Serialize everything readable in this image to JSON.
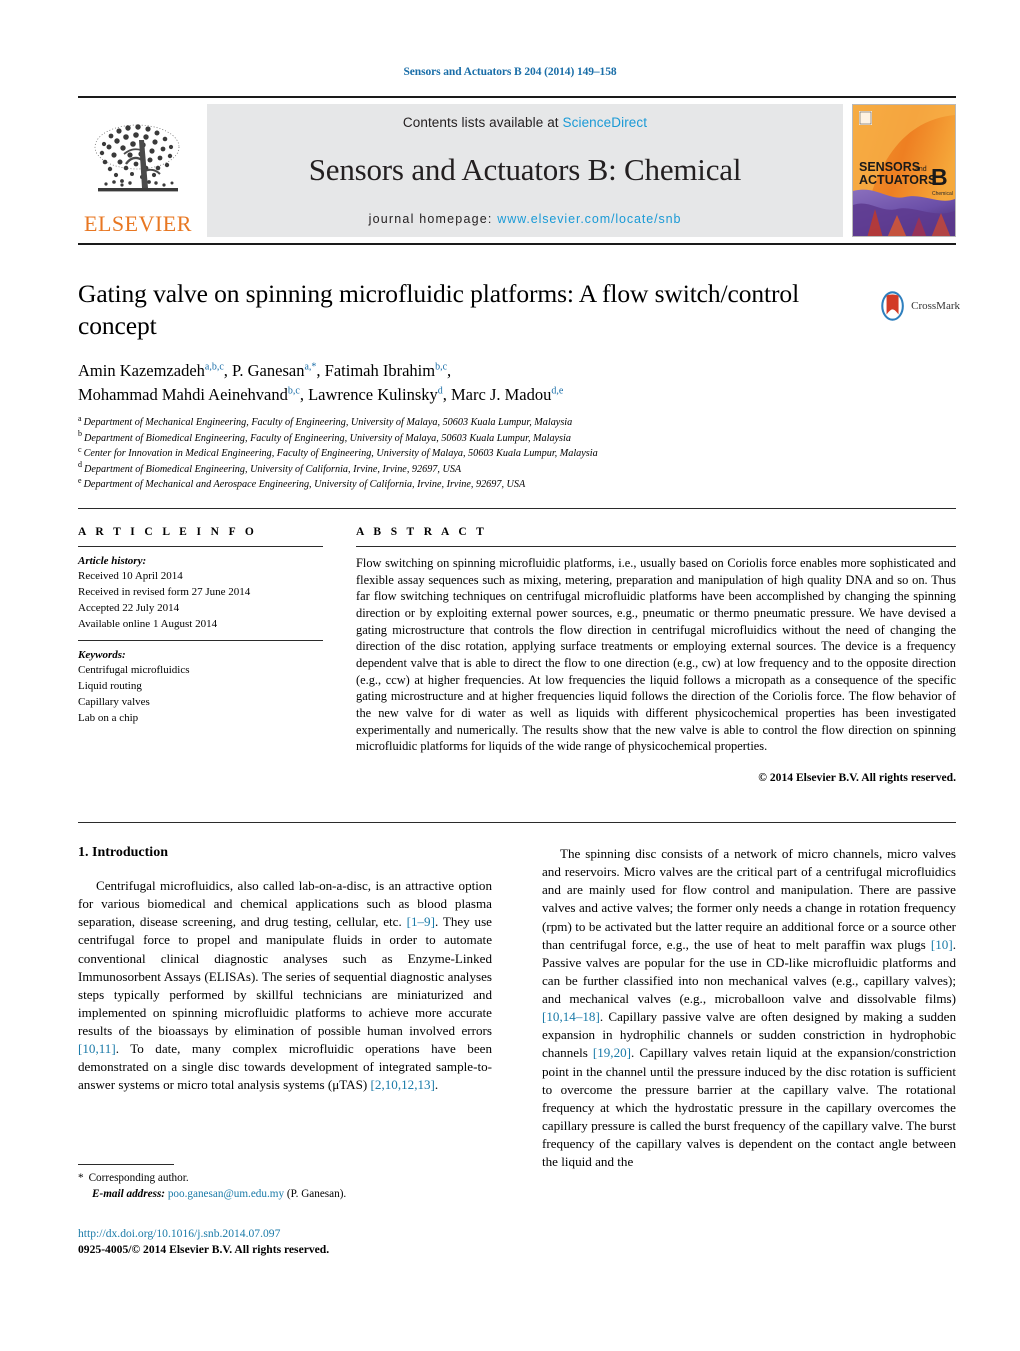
{
  "running_head": "Sensors and Actuators B 204 (2014) 149–158",
  "masthead": {
    "publisher_logo_label": "ELSEVIER",
    "contents_prefix": "Contents lists available at ",
    "contents_link": "ScienceDirect",
    "journal_title": "Sensors and Actuators B: Chemical",
    "homepage_prefix": "journal homepage: ",
    "homepage_link": "www.elsevier.com/locate/snb",
    "cover": {
      "line1": "SENSORS",
      "and": "and",
      "line2": "ACTUATORS",
      "letter": "B",
      "sub": "Chemical"
    }
  },
  "crossmark": {
    "label": "CrossMark"
  },
  "article": {
    "title": "Gating valve on spinning microfluidic platforms: A flow switch/control concept",
    "authors": [
      {
        "name": "Amin Kazemzadeh",
        "marks": "a,b,c",
        "sep": ", "
      },
      {
        "name": "P. Ganesan",
        "marks": "a,*",
        "sep": ", "
      },
      {
        "name": "Fatimah Ibrahim",
        "marks": "b,c",
        "sep": ","
      },
      {
        "name": "Mohammad Mahdi Aeinehvand",
        "marks": "b,c",
        "sep": ", "
      },
      {
        "name": "Lawrence Kulinsky",
        "marks": "d",
        "sep": ", "
      },
      {
        "name": "Marc J. Madou",
        "marks": "d,e",
        "sep": ""
      }
    ],
    "affiliations": [
      {
        "letter": "a",
        "text": "Department of Mechanical Engineering, Faculty of Engineering, University of Malaya, 50603 Kuala Lumpur, Malaysia"
      },
      {
        "letter": "b",
        "text": "Department of Biomedical Engineering, Faculty of Engineering, University of Malaya, 50603 Kuala Lumpur, Malaysia"
      },
      {
        "letter": "c",
        "text": "Center for Innovation in Medical Engineering, Faculty of Engineering, University of Malaya, 50603 Kuala Lumpur, Malaysia"
      },
      {
        "letter": "d",
        "text": "Department of Biomedical Engineering, University of California, Irvine, Irvine, 92697, USA"
      },
      {
        "letter": "e",
        "text": "Department of Mechanical and Aerospace Engineering, University of California, Irvine, Irvine, 92697, USA"
      }
    ]
  },
  "article_info": {
    "heading": "A R T I C L E    I N F O",
    "history_label": "Article history:",
    "history": [
      "Received 10 April 2014",
      "Received in revised form 27 June 2014",
      "Accepted 22 July 2014",
      "Available online 1 August 2014"
    ],
    "keywords_label": "Keywords:",
    "keywords": [
      "Centrifugal microfluidics",
      "Liquid routing",
      "Capillary valves",
      "Lab on a chip"
    ]
  },
  "abstract": {
    "heading": "A B S T R A C T",
    "text": "Flow switching on spinning microfluidic platforms, i.e., usually based on Coriolis force enables more sophisticated and flexible assay sequences such as mixing, metering, preparation and manipulation of high quality DNA and so on. Thus far flow switching techniques on centrifugal microfluidic platforms have been accomplished by changing the spinning direction or by exploiting external power sources, e.g., pneumatic or thermo pneumatic pressure. We have devised a gating microstructure that controls the flow direction in centrifugal microfluidics without the need of changing the direction of the disc rotation, applying surface treatments or employing external sources. The device is a frequency dependent valve that is able to direct the flow to one direction (e.g., cw) at low frequency and to the opposite direction (e.g., ccw) at higher frequencies. At low frequencies the liquid follows a micropath as a consequence of the specific gating microstructure and at higher frequencies liquid follows the direction of the Coriolis force. The flow behavior of the new valve for di water as well as liquids with different physicochemical properties has been investigated experimentally and numerically. The results show that the new valve is able to control the flow direction on spinning microfluidic platforms for liquids of the wide range of physicochemical properties.",
    "copyright": "© 2014 Elsevier B.V. All rights reserved."
  },
  "introduction": {
    "heading": "1.  Introduction",
    "left_paragraph_1_a": "Centrifugal microfluidics, also called lab-on-a-disc, is an attractive option for various biomedical and chemical applications such as blood plasma separation, disease screening, and drug testing, cellular, etc. ",
    "left_ref_1": "[1–9]",
    "left_paragraph_1_b": ". They use centrifugal force to propel and manipulate fluids in order to automate conventional clinical diagnostic analyses such as Enzyme-Linked Immunosorbent Assays (ELISAs). The series of sequential diagnostic analyses steps typically performed by skillful technicians are miniaturized and implemented on spinning microfluidic platforms to achieve more accurate results of the bioassays by elimination of possible human involved errors ",
    "left_ref_2": "[10,11]",
    "left_paragraph_1_c": ". To date, many complex microfluidic operations have been demonstrated on a single disc towards development of integrated sample-to-answer systems or micro total analysis systems (μTAS) ",
    "left_ref_3": "[2,10,12,13]",
    "left_paragraph_1_d": ".",
    "right_a": "The spinning disc consists of a network of micro channels, micro valves and reservoirs. Micro valves are the critical part of a centrifugal microfluidics and are mainly used for flow control and manipulation. There are passive valves and active valves; the former only needs a change in rotation frequency (rpm) to be activated but the latter require an additional force or a source other than centrifugal force, e.g., the use of heat to melt paraffin wax plugs ",
    "right_ref_1": "[10]",
    "right_b": ". Passive valves are popular for the use in CD-like microfluidic platforms and can be further classified into non mechanical valves (e.g., capillary valves); and mechanical valves (e.g., microballoon valve and dissolvable films) ",
    "right_ref_2": "[10,14–18]",
    "right_c": ". Capillary passive valve are often designed by making a sudden expansion in hydrophilic channels or sudden constriction in hydrophobic channels ",
    "right_ref_3": "[19,20]",
    "right_d": ". Capillary valves retain liquid at the expansion/constriction point in the channel until the pressure induced by the disc rotation is sufficient to overcome the pressure barrier at the capillary valve. The rotational frequency at which the hydrostatic pressure in the capillary overcomes the capillary pressure is called the burst frequency of the capillary valve. The burst frequency of the capillary valves is dependent on the contact angle between the liquid and the"
  },
  "footnote": {
    "star": "*",
    "corresponding": "Corresponding author.",
    "email_label": "E-mail address:",
    "email": "poo.ganesan@um.edu.my",
    "email_suffix": "(P. Ganesan)."
  },
  "doi": {
    "url": "http://dx.doi.org/10.1016/j.snb.2014.07.097",
    "issn_line": "0925-4005/© 2014 Elsevier B.V. All rights reserved."
  },
  "colors": {
    "link_blue": "#1a9ad6",
    "ref_blue": "#1a7aa8",
    "elsevier_orange": "#e87722",
    "band_gray": "#e6e7e8"
  }
}
